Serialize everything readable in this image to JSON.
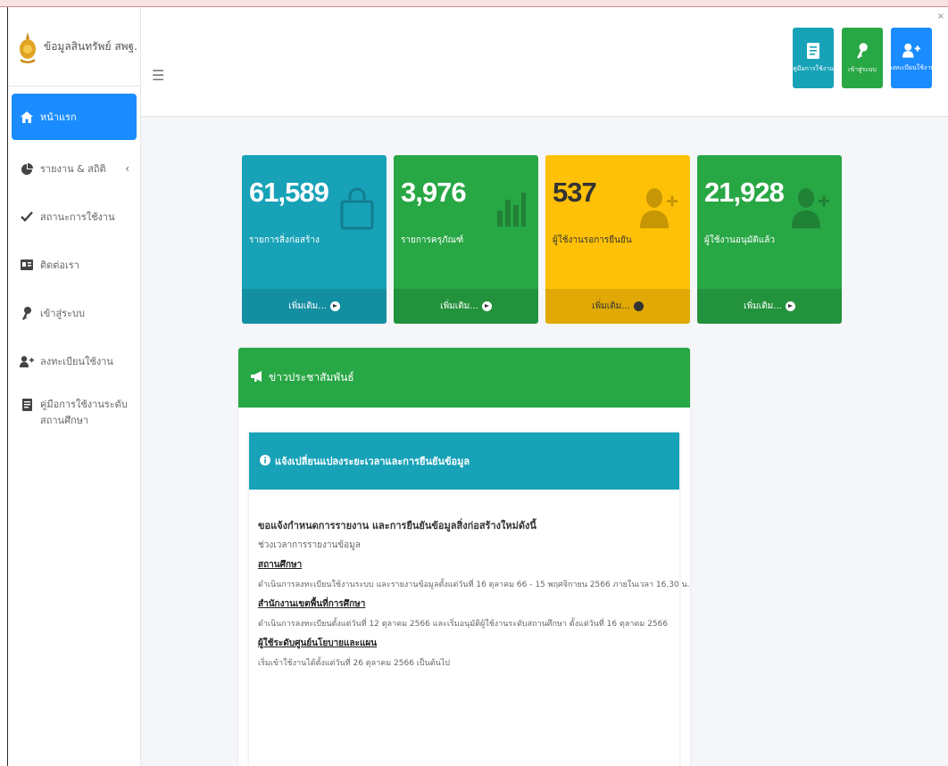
{
  "brand": {
    "title": "ข้อมูลสินทรัพย์ สพฐ."
  },
  "sidebar": {
    "items": [
      {
        "label": "หน้าแรก",
        "icon": "home-icon"
      },
      {
        "label": "รายงาน & สถิติ",
        "icon": "pie-chart-icon"
      },
      {
        "label": "สถานะการใช้งาน",
        "icon": "check-icon"
      },
      {
        "label": "ติดต่อเรา",
        "icon": "contact-card-icon"
      },
      {
        "label": "เข้าสู่ระบบ",
        "icon": "key-icon"
      },
      {
        "label": "ลงทะเบียนใช้งาน",
        "icon": "user-plus-icon"
      },
      {
        "label": "คู่มือการใช้งานระดับสถานศึกษา",
        "icon": "document-icon"
      }
    ]
  },
  "header": {
    "menu_icon": "☰",
    "buttons": [
      {
        "label": "คู่มือการใช้งาน",
        "color": "#17a2b8",
        "icon": "document-icon"
      },
      {
        "label": "เข้าสู่ระบบ",
        "color": "#28a745",
        "icon": "key-icon"
      },
      {
        "label": "ลงทะเบียนใช้งาน",
        "color": "#1a8cff",
        "icon": "user-plus-icon"
      }
    ]
  },
  "stats": [
    {
      "value": "61,589",
      "label": "รายการสิ่งก่อสร้าง",
      "more": "เพิ่มเติม...",
      "color": "#17a2b8",
      "icon": "shopping-bag-icon"
    },
    {
      "value": "3,976",
      "label": "รายการครุภัณฑ์",
      "more": "เพิ่มเติม...",
      "color": "#28a745",
      "icon": "bar-chart-icon"
    },
    {
      "value": "537",
      "label": "ผู้ใช้งานรอการยืนยัน",
      "more": "เพิ่มเติม...",
      "color": "#ffc107",
      "icon": "user-plus-icon"
    },
    {
      "value": "21,928",
      "label": "ผู้ใช้งานอนุมัติแล้ว",
      "more": "เพิ่มเติม...",
      "color": "#28a745",
      "icon": "user-plus-icon"
    }
  ],
  "news": {
    "title": "ข่าวประชาสัมพันธ์",
    "notice": {
      "title": "แจ้งเปลี่ยนแปลงระยะเวลาและการยืนยันข้อมูล",
      "heading": "ขอแจ้งกำหนดการรายงาน และการยืนยันข้อมูลสิ่งก่อสร้างใหม่ดังนี้",
      "subheading": "ช่วงเวลาการรายงานข้อมูล",
      "sections": [
        {
          "title": "สถานศึกษา",
          "text": "ดำเนินการลงทะเบียนใช้งานระบบ และรายงานข้อมูลตั้งแต่วันที่ 16 ตุลาคม 66 - 15 พฤศจิกายน 2566 ภายในเวลา 16.30 น."
        },
        {
          "title": "สำนักงานเขตพื้นที่การศึกษา",
          "text": "ดำเนินการลงทะเบียนตั้งแต่วันที่ 12 ตุลาคม 2566 และเริ่มอนุมัติผู้ใช้งานระดับสถานศึกษา ตั้งแต่วันที่ 16 ตุลาคม 2566"
        },
        {
          "title": "ผู้ใช้ระดับศูนย์นโยบายและแผน",
          "text": "เริ่มเข้าใช้งานได้ตั้งแต่วันที่ 26 ตุลาคม 2566 เป็นต้นไป"
        }
      ]
    }
  }
}
